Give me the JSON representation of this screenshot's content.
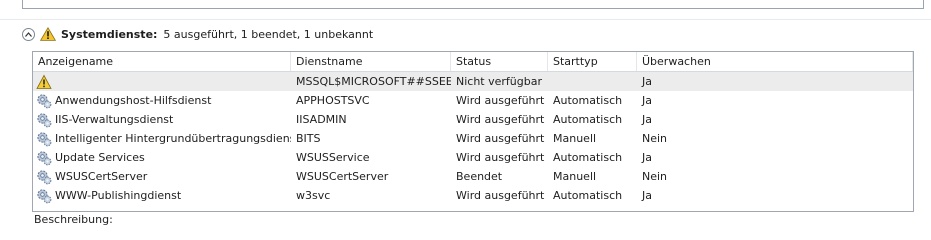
{
  "section": {
    "title": "Systemdienste:",
    "summary": "5 ausgeführt, 1 beendet, 1 unbekannt",
    "collapse_glyph": "^",
    "icon": "warning-icon"
  },
  "table": {
    "columns": [
      "Anzeigename",
      "Dienstname",
      "Status",
      "Starttyp",
      "Überwachen"
    ],
    "rows": [
      {
        "icon": "warning-icon",
        "display": "",
        "service": "MSSQL$MICROSOFT##SSEE",
        "status": "Nicht verfügbar",
        "start": "",
        "monitor": "Ja"
      },
      {
        "icon": "service-gear-icon",
        "display": "Anwendungshost-Hilfsdienst",
        "service": "APPHOSTSVC",
        "status": "Wird ausgeführt",
        "start": "Automatisch",
        "monitor": "Ja"
      },
      {
        "icon": "service-gear-icon",
        "display": "IIS-Verwaltungsdienst",
        "service": "IISADMIN",
        "status": "Wird ausgeführt",
        "start": "Automatisch",
        "monitor": "Ja"
      },
      {
        "icon": "service-gear-icon",
        "display": "Intelligenter Hintergrundübertragungsdienst",
        "service": "BITS",
        "status": "Wird ausgeführt",
        "start": "Manuell",
        "monitor": "Nein"
      },
      {
        "icon": "service-gear-icon",
        "display": "Update Services",
        "service": "WSUSService",
        "status": "Wird ausgeführt",
        "start": "Automatisch",
        "monitor": "Ja"
      },
      {
        "icon": "service-gear-icon",
        "display": "WSUSCertServer",
        "service": "WSUSCertServer",
        "status": "Beendet",
        "start": "Manuell",
        "monitor": "Nein"
      },
      {
        "icon": "service-gear-icon",
        "display": "WWW-Publishingdienst",
        "service": "w3svc",
        "status": "Wird ausgeführt",
        "start": "Automatisch",
        "monitor": "Ja"
      }
    ]
  },
  "description_label": "Beschreibung:"
}
